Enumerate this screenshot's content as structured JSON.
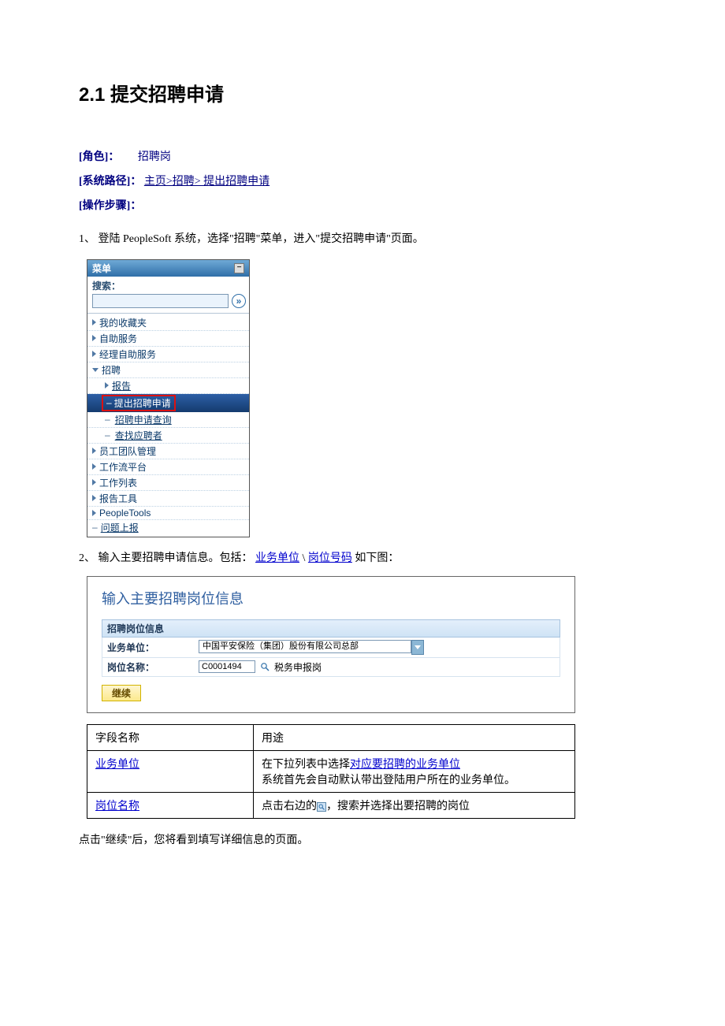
{
  "heading": "2.1 提交招聘申请",
  "role_label": "[角色]：",
  "role_value": "招聘岗",
  "path_label": "[系统路径]：",
  "path_value": "主页>招聘> 提出招聘申请",
  "steps_label": "[操作步骤]：",
  "step1": "1、 登陆 PeopleSoft 系统，选择\"招聘\"菜单，进入\"提交招聘申请\"页面。",
  "step2_pre": "2、 输入主要招聘申请信息。包括：",
  "step2_link1": "业务单位",
  "step2_sep": "\\ ",
  "step2_link2": "岗位号码",
  "step2_post": " 如下图：",
  "menu": {
    "title": "菜单",
    "search_label": "搜索：",
    "items": {
      "fav": "我的收藏夹",
      "self": "自助服务",
      "mgr": "经理自助服务",
      "recruit": "招聘",
      "report": "报告",
      "submit": "提出招聘申请",
      "query": "招聘申请查询",
      "find": "查找应聘者",
      "team": "员工团队管理",
      "wf": "工作流平台",
      "wl": "工作列表",
      "rpt": "报告工具",
      "pt": "PeopleTools",
      "issue": "问题上报"
    }
  },
  "form": {
    "title": "输入主要招聘岗位信息",
    "section": "招聘岗位信息",
    "bu_label": "业务单位：",
    "bu_value": "中国平安保险（集团）股份有限公司总部",
    "pos_label": "岗位名称：",
    "pos_code": "C0001494",
    "pos_desc": "税务申报岗",
    "continue": "继续"
  },
  "table": {
    "h1": "字段名称",
    "h2": "用途",
    "bu": "业务单位",
    "bu_pre": "在下拉列表中选择",
    "bu_bold": "对应要招聘的业务单位",
    "bu_line2": "系统首先会自动默认带出登陆用户所在的业务单位。",
    "pos": "岗位名称",
    "pos_pre": "点击右边的",
    "pos_post": "，搜索并选择出要招聘的岗位"
  },
  "after": "点击\"继续\"后，您将看到填写详细信息的页面。"
}
